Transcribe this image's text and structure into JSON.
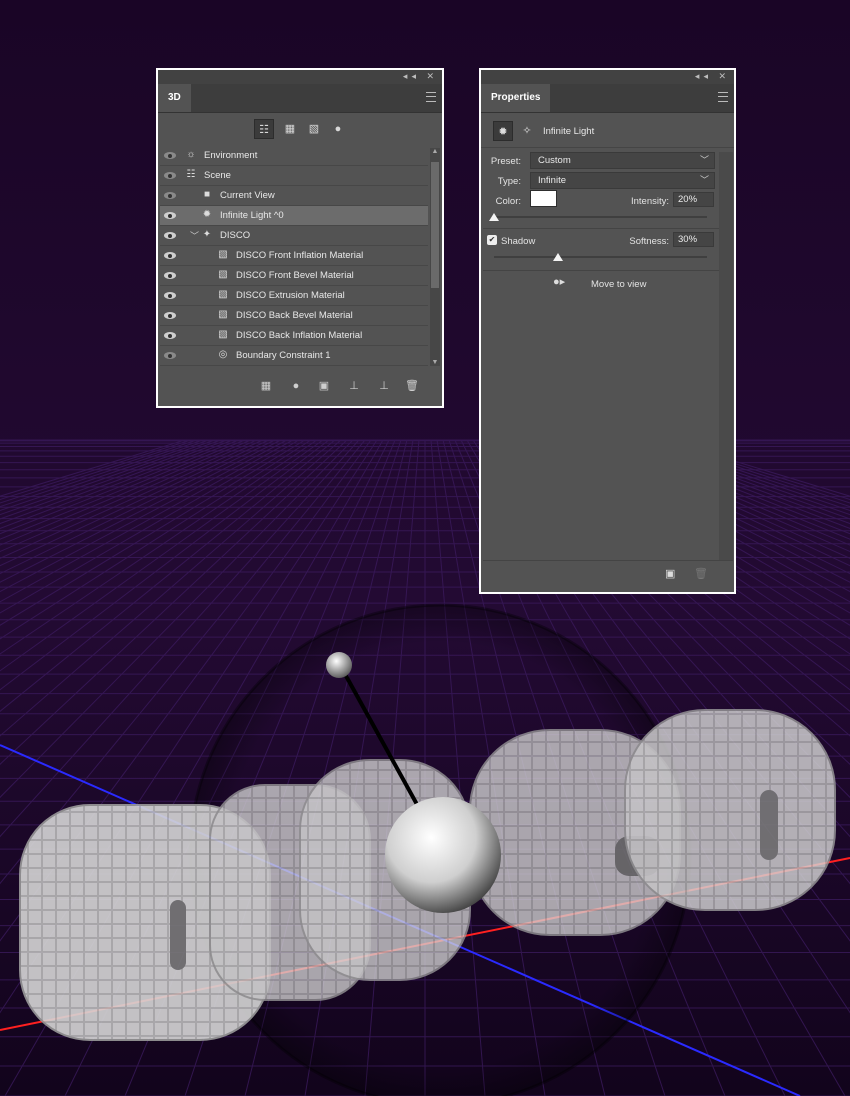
{
  "panel3d": {
    "tab_label": "3D",
    "controls": "◂◂ ✕",
    "layers": [
      {
        "label": "Environment",
        "visible": "dim",
        "indent": 0,
        "icon": "environment-icon",
        "glyph": "☼"
      },
      {
        "label": "Scene",
        "visible": "dim",
        "indent": 0,
        "icon": "scene-icon",
        "glyph": "☷"
      },
      {
        "label": "Current View",
        "visible": "dim",
        "indent": 1,
        "icon": "camera-icon",
        "glyph": "■"
      },
      {
        "label": "Infinite Light ^0",
        "visible": "on",
        "indent": 1,
        "icon": "infinite-light-icon",
        "glyph": "✹",
        "selected": true
      },
      {
        "label": "DISCO",
        "visible": "on",
        "indent": 1,
        "icon": "mesh-icon",
        "glyph": "✦",
        "expanded": true
      },
      {
        "label": "DISCO Front Inflation Material",
        "visible": "on",
        "indent": 2,
        "icon": "material-icon",
        "glyph": "▧"
      },
      {
        "label": "DISCO Front Bevel Material",
        "visible": "on",
        "indent": 2,
        "icon": "material-icon",
        "glyph": "▧"
      },
      {
        "label": "DISCO Extrusion Material",
        "visible": "on",
        "indent": 2,
        "icon": "material-icon",
        "glyph": "▧"
      },
      {
        "label": "DISCO Back Bevel Material",
        "visible": "on",
        "indent": 2,
        "icon": "material-icon",
        "glyph": "▧"
      },
      {
        "label": "DISCO Back Inflation Material",
        "visible": "on",
        "indent": 2,
        "icon": "material-icon",
        "glyph": "▧"
      },
      {
        "label": "Boundary Constraint 1",
        "visible": "dim",
        "indent": 2,
        "icon": "constraint-icon",
        "glyph": "◎"
      }
    ]
  },
  "props": {
    "tab_label": "Properties",
    "controls": "◂◂ ✕",
    "title": "Infinite Light",
    "preset_label": "Preset:",
    "preset_value": "Custom",
    "type_label": "Type:",
    "type_value": "Infinite",
    "color_label": "Color:",
    "color_value": "#ffffff",
    "intensity_label": "Intensity:",
    "intensity_value": "20%",
    "intensity_level": 0.0,
    "shadow_label": "Shadow",
    "shadow_checked": true,
    "softness_label": "Softness:",
    "softness_value": "30%",
    "softness_level": 0.3,
    "move_to_view_label": "Move to view"
  },
  "colors": {
    "background": "#1b0626",
    "grid": "#3a1a5c",
    "axis_x": "#ff2020",
    "axis_z": "#2a2aff",
    "panel": "#535353",
    "panel_border": "#ffffff"
  }
}
